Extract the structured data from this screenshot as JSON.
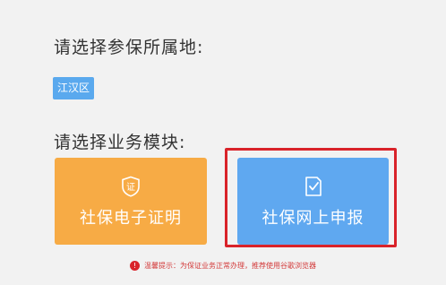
{
  "region_section": {
    "prompt": "请选择参保所属地:",
    "selected_district": "江汉区"
  },
  "module_section": {
    "prompt": "请选择业务模块:",
    "cards": [
      {
        "label": "社保电子证明",
        "icon": "certificate-shield-icon",
        "icon_glyph": "证",
        "color": "#f7ab45"
      },
      {
        "label": "社保网上申报",
        "icon": "document-check-icon",
        "color": "#5fa8f0"
      }
    ]
  },
  "highlight": {
    "color": "#d9232a"
  },
  "notice": {
    "icon": "info-icon",
    "icon_glyph": "!",
    "text": "温馨提示：为保证业务正常办理，推荐使用谷歌浏览器"
  }
}
